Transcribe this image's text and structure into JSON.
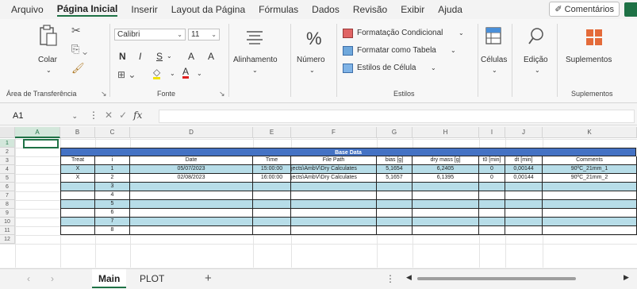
{
  "menu": {
    "items": [
      "Arquivo",
      "Página Inicial",
      "Inserir",
      "Layout da Página",
      "Fórmulas",
      "Dados",
      "Revisão",
      "Exibir",
      "Ajuda"
    ],
    "active_index": 1,
    "comments_label": "Comentários",
    "comments_icon": "comment-icon"
  },
  "ribbon": {
    "clipboard": {
      "paste_label": "Colar",
      "group_label": "Área de Transferência"
    },
    "font": {
      "font_name": "Calibri",
      "font_size": "11",
      "bold": "N",
      "italic": "I",
      "underline": "S",
      "grow": "A",
      "shrink": "A",
      "font_color": "A",
      "group_label": "Fonte"
    },
    "alignment": {
      "label": "Alinhamento"
    },
    "number": {
      "label": "Número",
      "symbol": "%"
    },
    "styles": {
      "conditional": "Formatação Condicional",
      "table": "Formatar como Tabela",
      "cell_styles": "Estilos de Célula",
      "group_label": "Estilos"
    },
    "cells": {
      "label": "Células"
    },
    "editing": {
      "label": "Edição"
    },
    "addins": {
      "label": "Suplementos",
      "group_label": "Suplementos"
    }
  },
  "formula_bar": {
    "name_box": "A1",
    "fx": "fx",
    "formula": ""
  },
  "grid": {
    "columns": [
      "A",
      "B",
      "C",
      "D",
      "E",
      "F",
      "G",
      "H",
      "I",
      "J",
      "K"
    ],
    "rows": [
      "1",
      "2",
      "3",
      "4",
      "5",
      "6",
      "7",
      "8",
      "9",
      "10",
      "11",
      "12"
    ],
    "selected_cell": "A1",
    "table_title": "Base Data",
    "headers": [
      "Treat",
      "i",
      "Date",
      "Time",
      "File Path",
      "bias [g]",
      "dry mass [g]",
      "t0 [min]",
      "dt [min]",
      "Comments"
    ],
    "rows_data": [
      [
        "X",
        "1",
        "05/07/2023",
        "15:00:00",
        "jects\\AmbV\\Dry Calculates",
        "5,1654",
        "6,2405",
        "0",
        "0,00144",
        "90ºC_21mm_1"
      ],
      [
        "X",
        "2",
        "02/08/2023",
        "16:00:00",
        "jects\\AmbV\\Dry Calculates",
        "5,1657",
        "6,1395",
        "0",
        "0,00144",
        "90ºC_21mm_2"
      ],
      [
        "",
        "3",
        "",
        "",
        "",
        "",
        "",
        "",
        "",
        ""
      ],
      [
        "",
        "4",
        "",
        "",
        "",
        "",
        "",
        "",
        "",
        ""
      ],
      [
        "",
        "5",
        "",
        "",
        "",
        "",
        "",
        "",
        "",
        ""
      ],
      [
        "",
        "6",
        "",
        "",
        "",
        "",
        "",
        "",
        "",
        ""
      ],
      [
        "",
        "7",
        "",
        "",
        "",
        "",
        "",
        "",
        "",
        ""
      ],
      [
        "",
        "8",
        "",
        "",
        "",
        "",
        "",
        "",
        "",
        ""
      ]
    ],
    "row_fill_color": "#b7dde8",
    "title_fill_color": "#4472c4"
  },
  "sheets": {
    "tabs": [
      "Main",
      "PLOT"
    ],
    "active": "Main",
    "add_label": "+"
  },
  "accent_color": "#1e7145"
}
